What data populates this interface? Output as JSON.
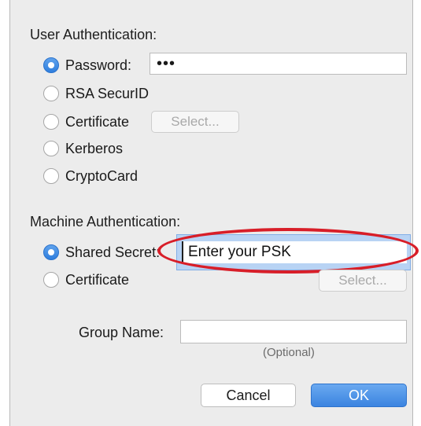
{
  "user_auth": {
    "heading": "User Authentication:",
    "options": [
      {
        "label": "Password:",
        "selected": true
      },
      {
        "label": "RSA SecurID",
        "selected": false
      },
      {
        "label": "Certificate",
        "selected": false
      },
      {
        "label": "Kerberos",
        "selected": false
      },
      {
        "label": "CryptoCard",
        "selected": false
      }
    ],
    "password_value": "•••",
    "select_button": "Select..."
  },
  "machine_auth": {
    "heading": "Machine Authentication:",
    "options": [
      {
        "label": "Shared Secret:",
        "selected": true
      },
      {
        "label": "Certificate",
        "selected": false
      }
    ],
    "shared_secret_value": "Enter your PSK",
    "select_button": "Select..."
  },
  "group": {
    "label": "Group Name:",
    "value": "",
    "hint": "(Optional)"
  },
  "buttons": {
    "cancel": "Cancel",
    "ok": "OK"
  },
  "colors": {
    "accent": "#3b84e0",
    "highlight": "#d81e28",
    "background": "#ececec"
  }
}
